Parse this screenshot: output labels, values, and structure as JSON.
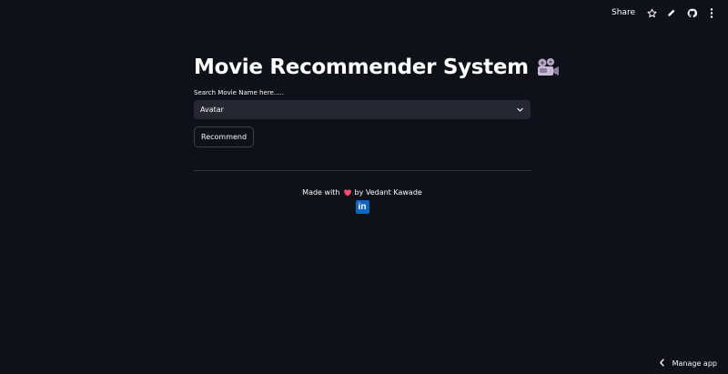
{
  "topbar": {
    "share_label": "Share",
    "icons": [
      "star-icon",
      "pencil-icon",
      "github-icon",
      "more-vertical-icon"
    ]
  },
  "main": {
    "title": "Movie Recommender System",
    "title_icon": "film-projector-icon",
    "search_label": "Search Movie Name here.....",
    "selected_movie": "Avatar",
    "recommend_label": "Recommend"
  },
  "footer": {
    "made_with": "Made with",
    "heart_icon": "heart-icon",
    "author": "by Vedant Kawade",
    "linkedin_icon": "linkedin-icon",
    "linkedin_text": "in"
  },
  "manage": {
    "label": "Manage app",
    "icon": "chevron-left-icon"
  },
  "colors": {
    "background": "#0e1117",
    "select_background": "#262730",
    "heart": "#ff4b6e",
    "linkedin": "#0a66c2"
  }
}
